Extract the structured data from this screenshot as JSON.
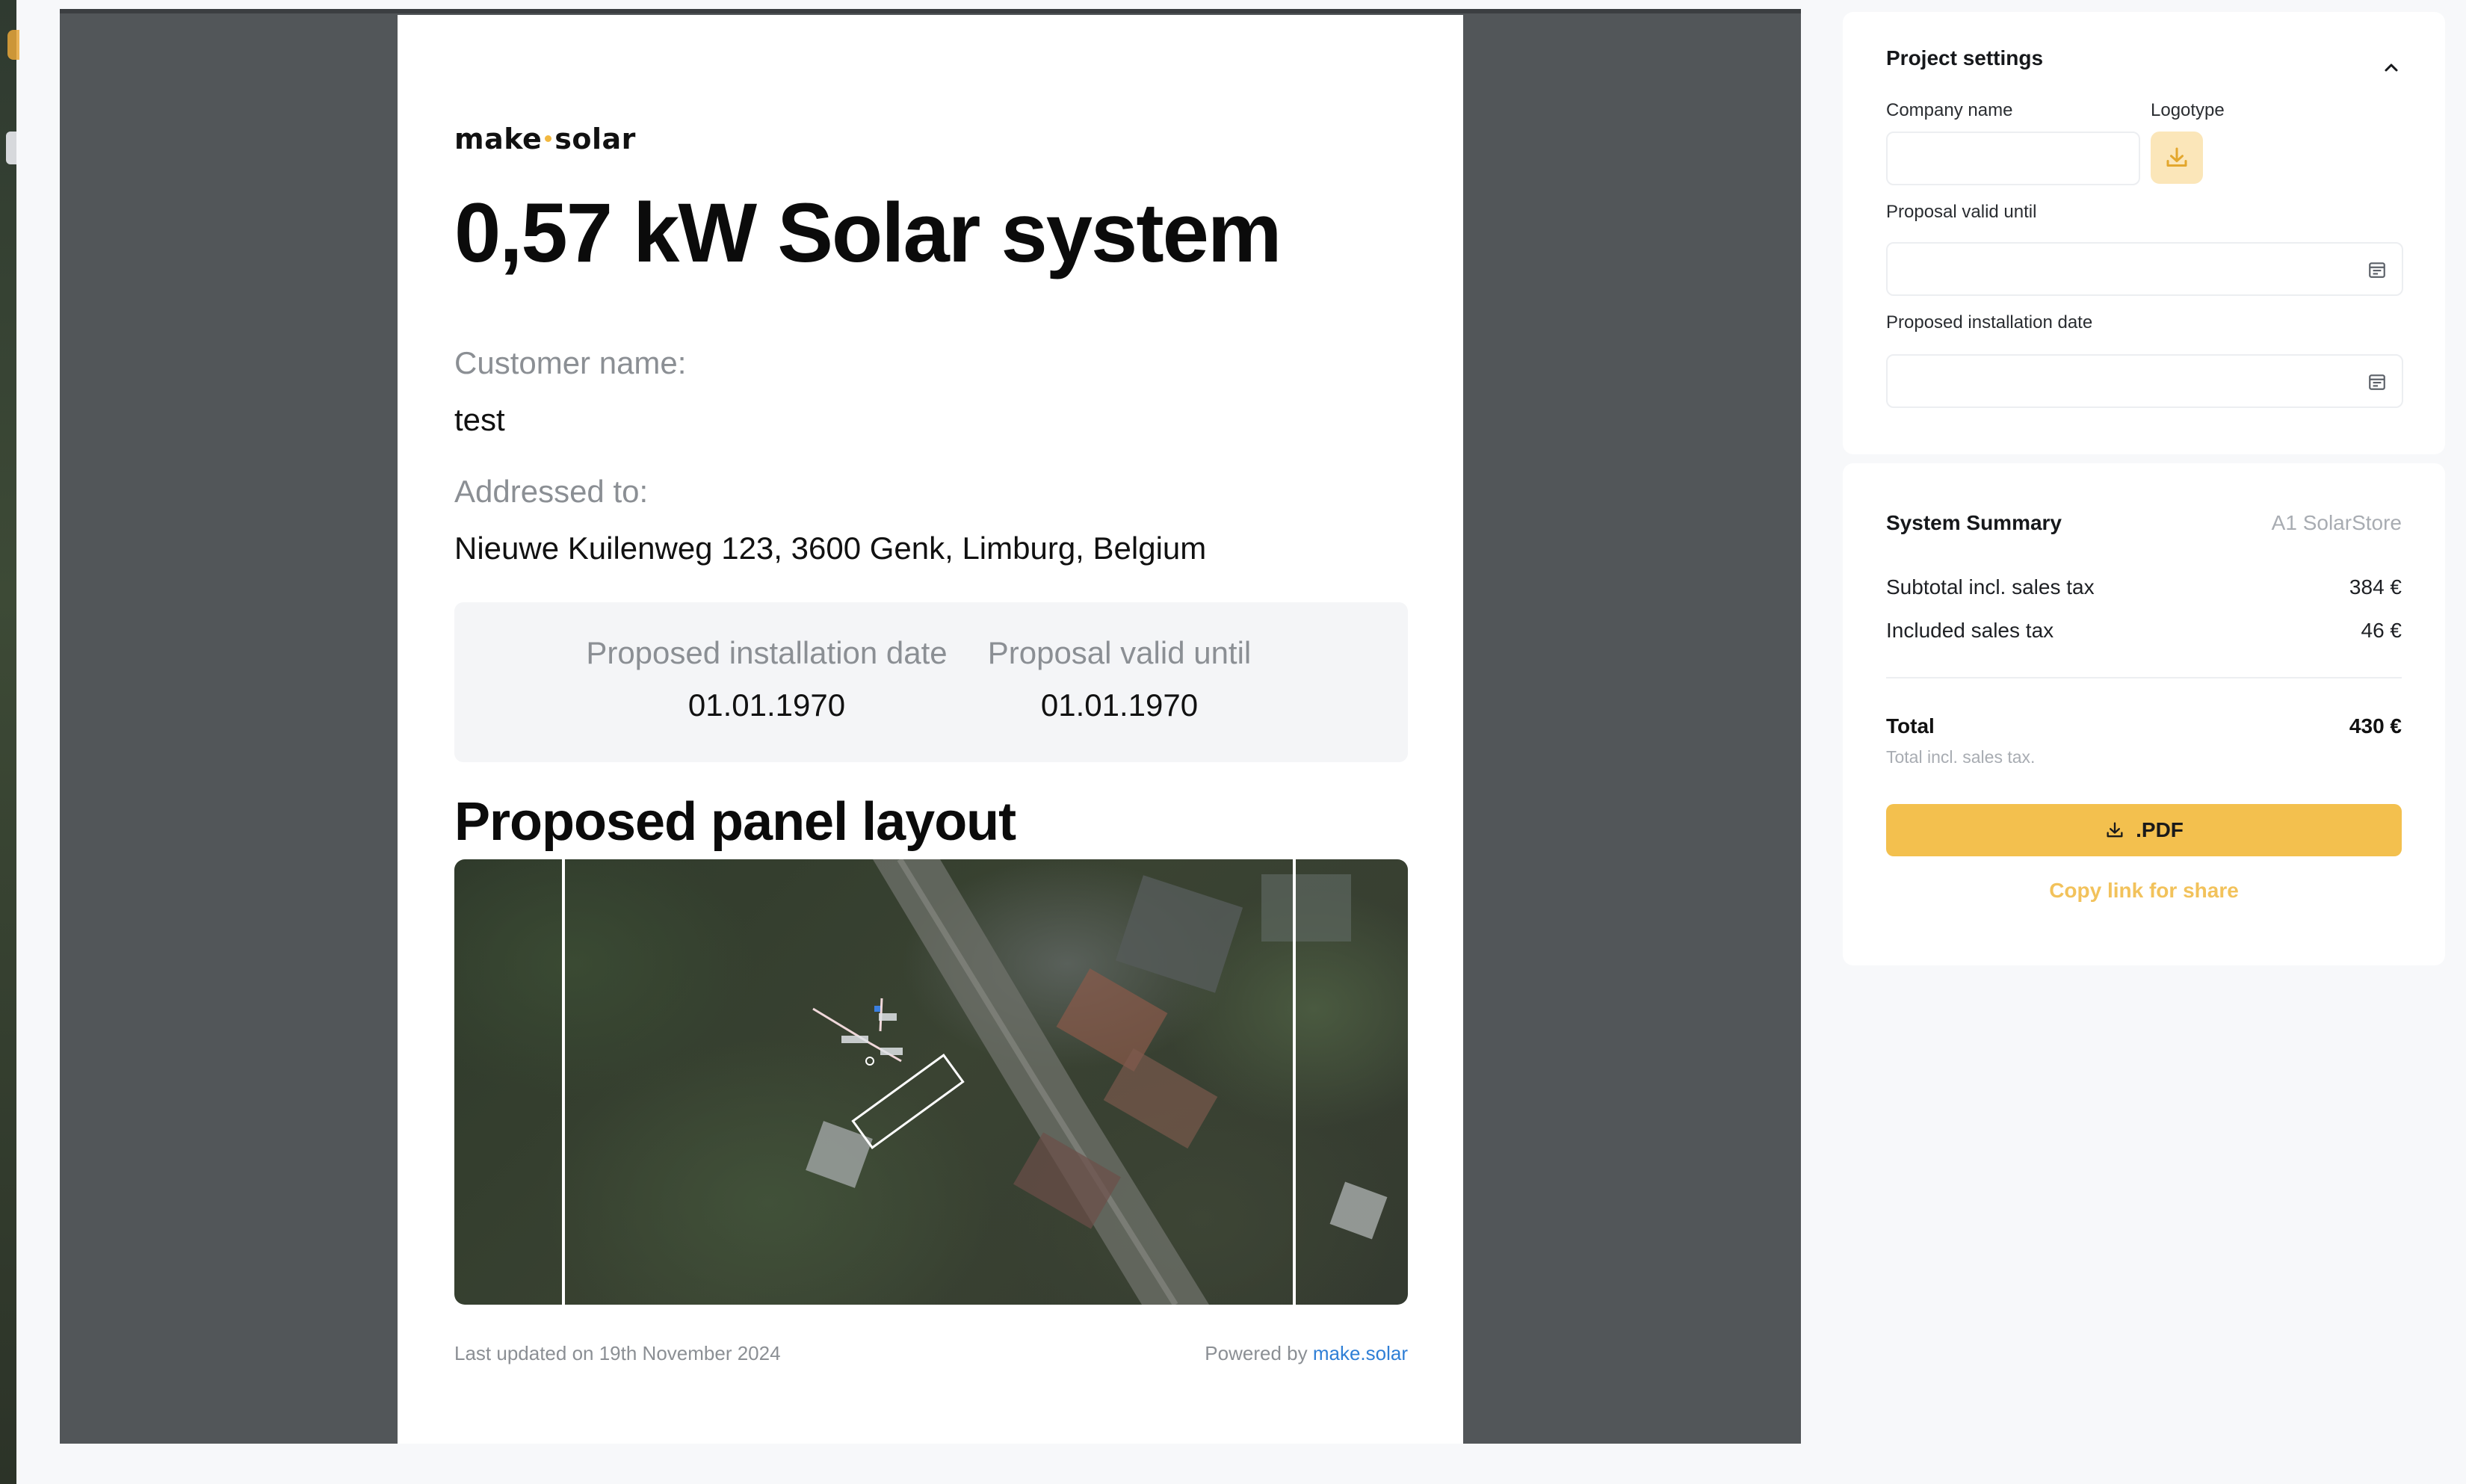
{
  "proposal": {
    "logo_left": "make",
    "logo_right": "solar",
    "title": "0,57 kW Solar system",
    "customer_label": "Customer name:",
    "customer_value": "test",
    "address_label": "Addressed to:",
    "address_value": "Nieuwe Kuilenweg 123, 3600 Genk, Limburg, Belgium",
    "install_date_label": "Proposed installation date",
    "install_date_value": "01.01.1970",
    "valid_until_label": "Proposal valid until",
    "valid_until_value": "01.01.1970",
    "layout_title": "Proposed panel layout",
    "footer_updated": "Last updated on 19th November 2024",
    "footer_powered": "Powered by",
    "footer_link": "make.solar"
  },
  "settings": {
    "title": "Project settings",
    "company_label": "Company name",
    "company_value": "",
    "logotype_label": "Logotype",
    "valid_until_label": "Proposal valid until",
    "valid_until_value": "",
    "install_date_label": "Proposed installation date",
    "install_date_value": ""
  },
  "summary": {
    "title": "System Summary",
    "store": "A1 SolarStore",
    "subtotal_label": "Subtotal incl. sales tax",
    "subtotal_value": "384 €",
    "tax_label": "Included sales tax",
    "tax_value": "46 €",
    "total_label": "Total",
    "total_value": "430 €",
    "total_note": "Total incl. sales tax.",
    "pdf_label": ".PDF",
    "share_label": "Copy link for share"
  },
  "icons": {
    "calendar": "calendar-icon",
    "download": "download-icon",
    "chevron": "chevron-up-icon"
  },
  "colors": {
    "accent": "#f3c04e",
    "accent_light": "#fbe6b9",
    "link": "#2f7fd6",
    "viewer_bg": "#525659"
  }
}
